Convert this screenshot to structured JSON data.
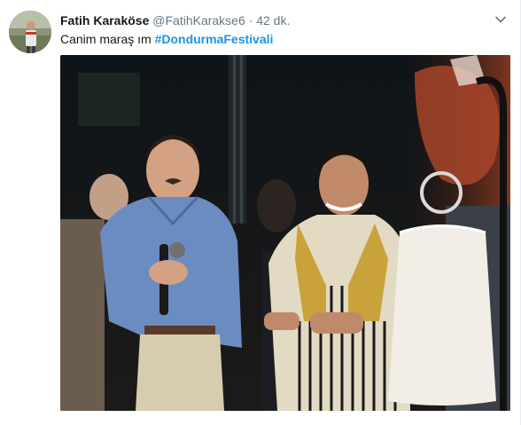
{
  "tweet": {
    "display_name": "Fatih Karaköse",
    "handle": "@FatihKarakse6",
    "separator": "·",
    "time": "42 dk.",
    "text": "Canim maraş ım",
    "hashtag": "#DondurmaFestivali"
  },
  "icons": {
    "more": "chevron-down-icon"
  },
  "colors": {
    "name": "#14171a",
    "meta": "#657786",
    "link": "#1b95e0",
    "background": "#ffffff"
  }
}
